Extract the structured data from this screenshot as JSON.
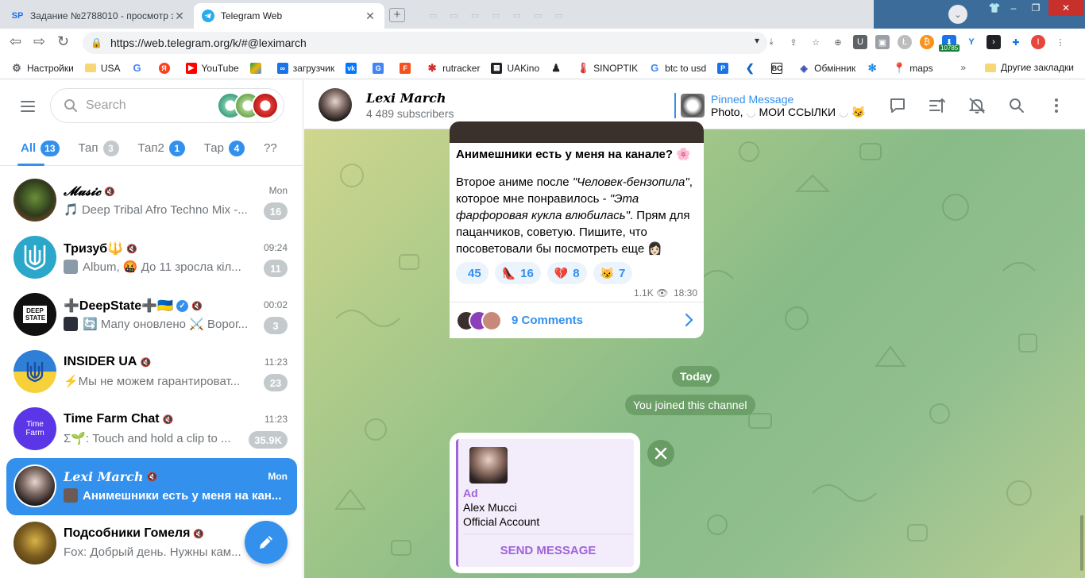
{
  "browser": {
    "tabs": [
      {
        "favicon": "SP",
        "title": "Задание №2788010 - просмотр з",
        "close": "✕"
      },
      {
        "favicon": "telegram-icon",
        "title": "Telegram Web",
        "close": "✕"
      }
    ],
    "new_tab": "+",
    "url": "https://web.telegram.org/k/#@leximarch",
    "extension_badge": "10785",
    "profile_letter": "I",
    "bookmarks": [
      {
        "icon": "gear-icon",
        "label": "Настройки"
      },
      {
        "icon": "folder-icon",
        "label": "USA"
      },
      {
        "icon": "google-icon",
        "label": ""
      },
      {
        "icon": "yandex-icon",
        "label": ""
      },
      {
        "icon": "youtube-icon",
        "label": "YouTube"
      },
      {
        "icon": "drive-icon",
        "label": ""
      },
      {
        "icon": "infinity-icon",
        "label": "загрузчик"
      },
      {
        "icon": "vk-icon",
        "label": ""
      },
      {
        "icon": "translate-icon",
        "label": ""
      },
      {
        "icon": "f-icon",
        "label": ""
      },
      {
        "icon": "rutracker-icon",
        "label": "rutracker"
      },
      {
        "icon": "uakino-icon",
        "label": "UAKino"
      },
      {
        "icon": "figure-icon",
        "label": ""
      },
      {
        "icon": "thermometer-icon",
        "label": "SINOPTIK"
      },
      {
        "icon": "google-icon",
        "label": "btc to usd"
      },
      {
        "icon": "p-icon",
        "label": ""
      },
      {
        "icon": "arrow-icon",
        "label": ""
      },
      {
        "icon": "bc-icon",
        "label": ""
      },
      {
        "icon": "exchange-icon",
        "label": "Обмінник"
      },
      {
        "icon": "snowflake-icon",
        "label": ""
      },
      {
        "icon": "maps-icon",
        "label": "maps"
      }
    ],
    "more": "»",
    "other_bookmarks": "Другие закладки"
  },
  "sidebar": {
    "search_placeholder": "Search",
    "folders": [
      {
        "label": "All",
        "count": "13"
      },
      {
        "label": "Тап",
        "count": "3"
      },
      {
        "label": "Тап2",
        "count": "1"
      },
      {
        "label": "Тар",
        "count": "4"
      },
      {
        "label": "??",
        "count": ""
      }
    ],
    "chats": [
      {
        "name": "𝓜𝓾𝓼𝓲𝓬",
        "time": "Mon",
        "preview": "🎵 Deep Tribal Afro Techno Mix -...",
        "badge": "16"
      },
      {
        "name": "Тризуб🔱",
        "time": "09:24",
        "preview": "Album, 🤬 До 11 зросла кіл...",
        "badge": "11"
      },
      {
        "name": "➕DeepState➕🇺🇦",
        "time": "00:02",
        "preview": "🔄 Мапу оновлено ⚔️ Ворог...",
        "badge": "3"
      },
      {
        "name": "INSIDER UA",
        "time": "11:23",
        "preview": "⚡Мы не можем гарантироват...",
        "badge": "23"
      },
      {
        "name": "Time Farm Chat",
        "time": "11:23",
        "preview": "Σ🌱: Touch and hold a clip to ...",
        "badge": "35.9K"
      },
      {
        "name": "Lexi March",
        "time": "Mon",
        "preview": "Анимешники есть у меня на кан...",
        "badge": ""
      },
      {
        "name": "Подсобники Гомеля",
        "time": "",
        "preview": "Fox: Добрый день. Нужны кам...",
        "badge": ""
      }
    ],
    "avatar_labels": {
      "deepstate": "DEEP STATE",
      "timefarm": "Time Farm"
    }
  },
  "chat": {
    "title": "Lexi March",
    "subscribers": "4 489 subscribers",
    "pinned_title": "Pinned Message",
    "pinned_prefix": "Photo,",
    "pinned_text": "МОИ ССЫЛКИ",
    "post": {
      "heading": "Анимешники есть у меня на канале? 🌸",
      "p1_a": "Второе аниме после ",
      "p1_b": "\"Человек-бензопила\"",
      "p1_c": ", которое мне понравилось  - ",
      "p1_d": "\"Эта фарфоровая кукла влюбилась\"",
      "p1_e": ". Прям для пацанчиков, советую. Пишите, что посоветовали бы посмотреть еще 👩🏻",
      "reactions": [
        {
          "emoji": "",
          "count": "45"
        },
        {
          "emoji": "👠",
          "count": "16"
        },
        {
          "emoji": "💔",
          "count": "8"
        },
        {
          "emoji": "😼",
          "count": "7"
        }
      ],
      "views": "1.1K",
      "time": "18:30",
      "comments": "9 Comments"
    },
    "date_pill": "Today",
    "service_message": "You joined this channel",
    "ad": {
      "label": "Ad",
      "name": "Alex Mucci",
      "text": "Official Account",
      "button": "SEND MESSAGE"
    }
  },
  "colors": {
    "accent": "#3390ec",
    "ad_accent": "#a063d9",
    "badge_muted": "#c4c9cc"
  }
}
